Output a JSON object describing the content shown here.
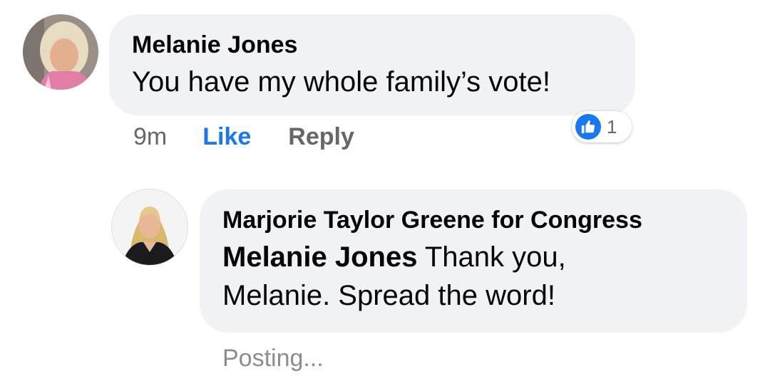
{
  "comment": {
    "author": "Melanie Jones",
    "text": "You have my whole family’s vote!",
    "time": "9m",
    "like_label": "Like",
    "reply_label": "Reply",
    "reaction_icon": "thumbs-up-icon",
    "reaction_count": "1"
  },
  "reply": {
    "author": "Marjorie Taylor Greene for Congress",
    "mention": "Melanie Jones",
    "text_line_1": " Thank you,",
    "text_line_2": "Melanie. Spread the word!",
    "status": "Posting..."
  },
  "colors": {
    "bubble": "#f0f2f5",
    "like_blue": "#1877f2",
    "secondary_text": "#65676b",
    "posting_text": "#8a8d91"
  }
}
